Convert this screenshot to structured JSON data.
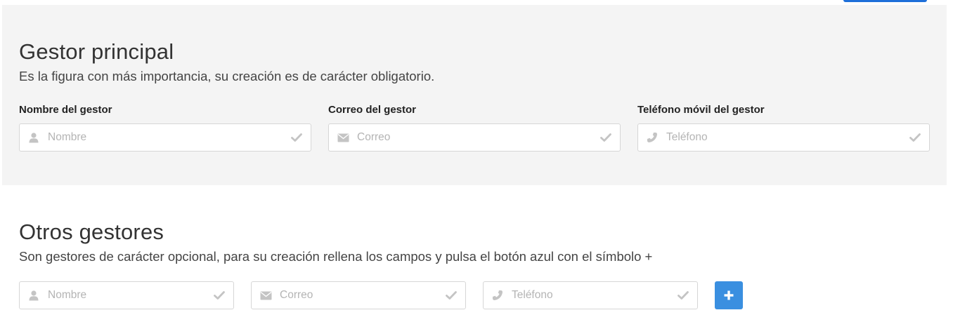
{
  "main_section": {
    "title": "Gestor principal",
    "subtitle": "Es la figura con más importancia, su creación es de carácter obligatorio.",
    "fields": [
      {
        "label": "Nombre del gestor",
        "placeholder": "Nombre",
        "value": "",
        "icon": "user-icon"
      },
      {
        "label": "Correo del gestor",
        "placeholder": "Correo",
        "value": "",
        "icon": "envelope-icon"
      },
      {
        "label": "Teléfono móvil del gestor",
        "placeholder": "Teléfono",
        "value": "",
        "icon": "phone-icon"
      }
    ]
  },
  "other_section": {
    "title": "Otros gestores",
    "subtitle": "Son gestores de carácter opcional, para su creación rellena los campos y pulsa el botón azul con el símbolo +",
    "fields": [
      {
        "placeholder": "Nombre",
        "value": "",
        "icon": "user-icon"
      },
      {
        "placeholder": "Correo",
        "value": "",
        "icon": "envelope-icon"
      },
      {
        "placeholder": "Teléfono",
        "value": "",
        "icon": "phone-icon"
      }
    ],
    "add_button_label": "+"
  },
  "colors": {
    "panel_bg": "#f4f4f4",
    "accent": "#3a8fe0",
    "icon_gray": "#c4c4c4",
    "border": "#d6d6d6"
  }
}
